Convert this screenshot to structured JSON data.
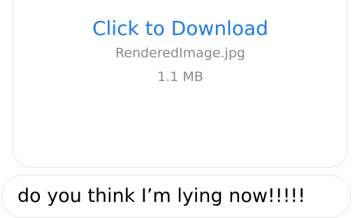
{
  "attachment": {
    "link_label": "Click to Download",
    "file_name": "RenderedImage.jpg",
    "file_size": "1.1 MB"
  },
  "message": {
    "text": "do you think I’m lying now!!!!!"
  },
  "colors": {
    "link": "#1a7cf5",
    "secondary_text": "#8a8a8e",
    "bubble_border": "#e2e2e2",
    "text": "#000000"
  }
}
